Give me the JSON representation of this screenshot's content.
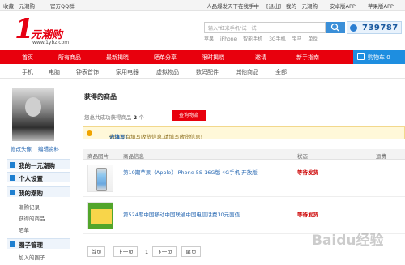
{
  "topbar": {
    "bookmark": "收藏一元潮购",
    "qq_group": "官方QQ群",
    "slogan": "人品爆发天下在我手中",
    "logout": "[退出]",
    "my_account": "我的一元潮购",
    "android_app": "安卓版APP",
    "iphone_app": "苹果版APP"
  },
  "logo": {
    "numeral": "1",
    "text": "元潮购",
    "url": "www.1ybz.com"
  },
  "search": {
    "placeholder": "输入\"红米手机\"试一试",
    "hot_words": [
      "苹果",
      "iPhone",
      "智能手机",
      "3G手机",
      "宝马",
      "单反"
    ]
  },
  "counter": {
    "value": "739787"
  },
  "nav": {
    "items": [
      "首页",
      "所有商品",
      "最新揭晓",
      "晒单分享",
      "限时揭晓",
      "邀请",
      "新手指南"
    ],
    "cart_label": "购物车 0"
  },
  "categories": [
    "手机",
    "电脑",
    "钟表首饰",
    "家用电器",
    "虚拟物品",
    "数码配件",
    "其他商品",
    "全部"
  ],
  "sidebar": {
    "edit_avatar": "修改头像",
    "edit_profile": "编辑资料",
    "sections": [
      "我的一元潮购",
      "个人设置",
      "我的潮购",
      "圈子管理"
    ],
    "items": [
      "潮购记录",
      "获得的商品",
      "晒单",
      "加入的圈子"
    ]
  },
  "main": {
    "title": "获得的商品",
    "info_prefix": "您总共成功获得商品",
    "info_count": "2",
    "info_suffix": "个",
    "check_logistics": "查询物流",
    "notice": "你还没有填写收货信息,请填写收货信息!",
    "notice_link": "去填写!",
    "table_headers": [
      "商品图片",
      "商品信息",
      "状态",
      "运费"
    ],
    "rows": [
      {
        "name": "第10期苹果（Apple）iPhone 5S 16G版 4G手机 开放版",
        "status": "等待发货"
      },
      {
        "name": "第524期中国移动中国联通中国电信话费10元面值",
        "status": "等待发货"
      }
    ],
    "pager": {
      "first": "首页",
      "prev": "上一页",
      "current": "1",
      "next": "下一页",
      "last": "尾页"
    }
  },
  "watermark": "Baidu经验",
  "colors": {
    "brand_red": "#e8000d",
    "accent_blue": "#1e8ee0",
    "status_red": "#cc0000"
  }
}
